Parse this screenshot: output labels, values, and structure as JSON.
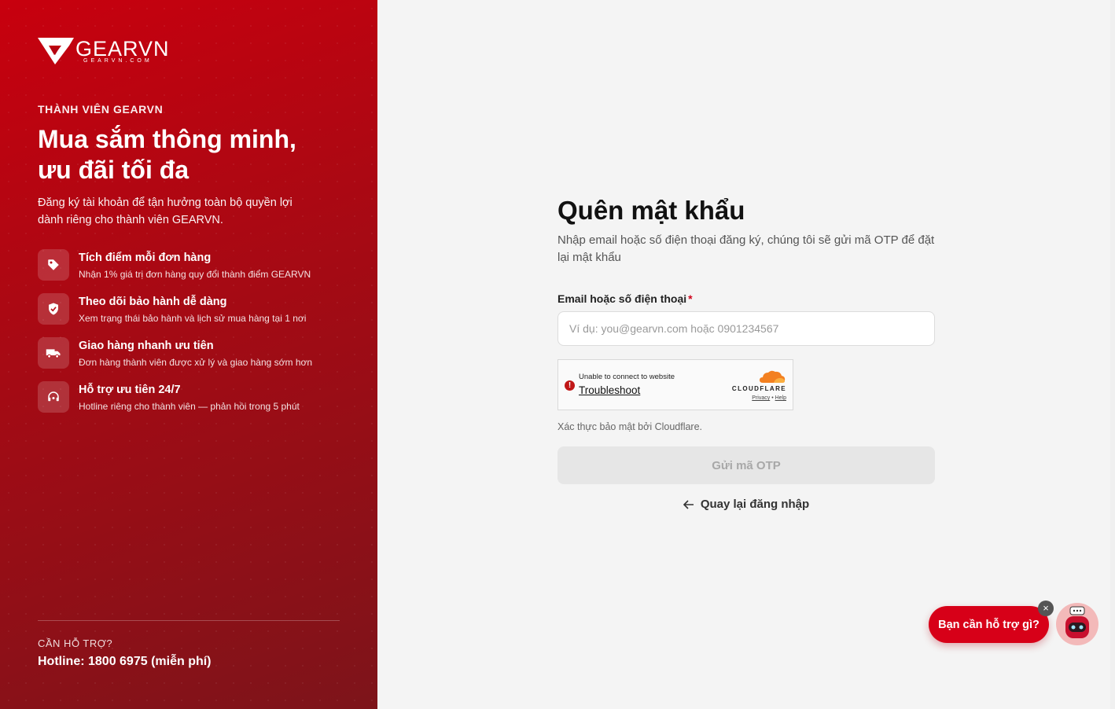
{
  "brand": {
    "name": "GEARVN",
    "domain": "GEARVN.COM"
  },
  "left_panel": {
    "eyebrow": "THÀNH VIÊN GEARVN",
    "headline_line1": "Mua sắm thông minh,",
    "headline_line2": "ưu đãi tối đa",
    "intro": "Đăng ký tài khoản để tận hưởng toàn bộ quyền lợi dành riêng cho thành viên GEARVN.",
    "benefits": [
      {
        "icon": "tag-icon",
        "title": "Tích điểm mỗi đơn hàng",
        "desc": "Nhận 1% giá trị đơn hàng quy đổi thành điểm GEARVN"
      },
      {
        "icon": "shield-check-icon",
        "title": "Theo dõi bảo hành dễ dàng",
        "desc": "Xem trạng thái bảo hành và lịch sử mua hàng tại 1 nơi"
      },
      {
        "icon": "truck-icon",
        "title": "Giao hàng nhanh ưu tiên",
        "desc": "Đơn hàng thành viên được xử lý và giao hàng sớm hơn"
      },
      {
        "icon": "headset-icon",
        "title": "Hỗ trợ ưu tiên 24/7",
        "desc": "Hotline riêng cho thành viên — phản hồi trong 5 phút"
      }
    ],
    "support_label": "CẦN HỖ TRỢ?",
    "hotline": "Hotline: 1800 6975 (miễn phí)"
  },
  "form": {
    "title": "Quên mật khẩu",
    "subtitle": "Nhập email hoặc số điện thoại đăng ký, chúng tôi sẽ gửi mã OTP để đặt lại mật khẩu",
    "field_label": "Email hoặc số điện thoại",
    "required_mark": "*",
    "input_value": "",
    "input_placeholder": "Ví dụ: you@gearvn.com hoặc 0901234567",
    "captcha": {
      "error_mark": "!",
      "message": "Unable to connect to website",
      "link": "Troubleshoot",
      "provider": "CLOUDFLARE",
      "privacy": "Privacy",
      "separator": "•",
      "help": "Help"
    },
    "captcha_note": "Xác thực bảo mật bởi Cloudflare.",
    "submit_label": "Gửi mã OTP",
    "back_label": "Quay lại đăng nhập"
  },
  "chat": {
    "bubble": "Bạn cần hỗ trợ gì?",
    "close": "×"
  },
  "colors": {
    "brand_red": "#d70018",
    "panel_dark": "#7d141a",
    "disabled_bg": "#e6e6e6",
    "cloudflare_orange": "#f38020"
  }
}
